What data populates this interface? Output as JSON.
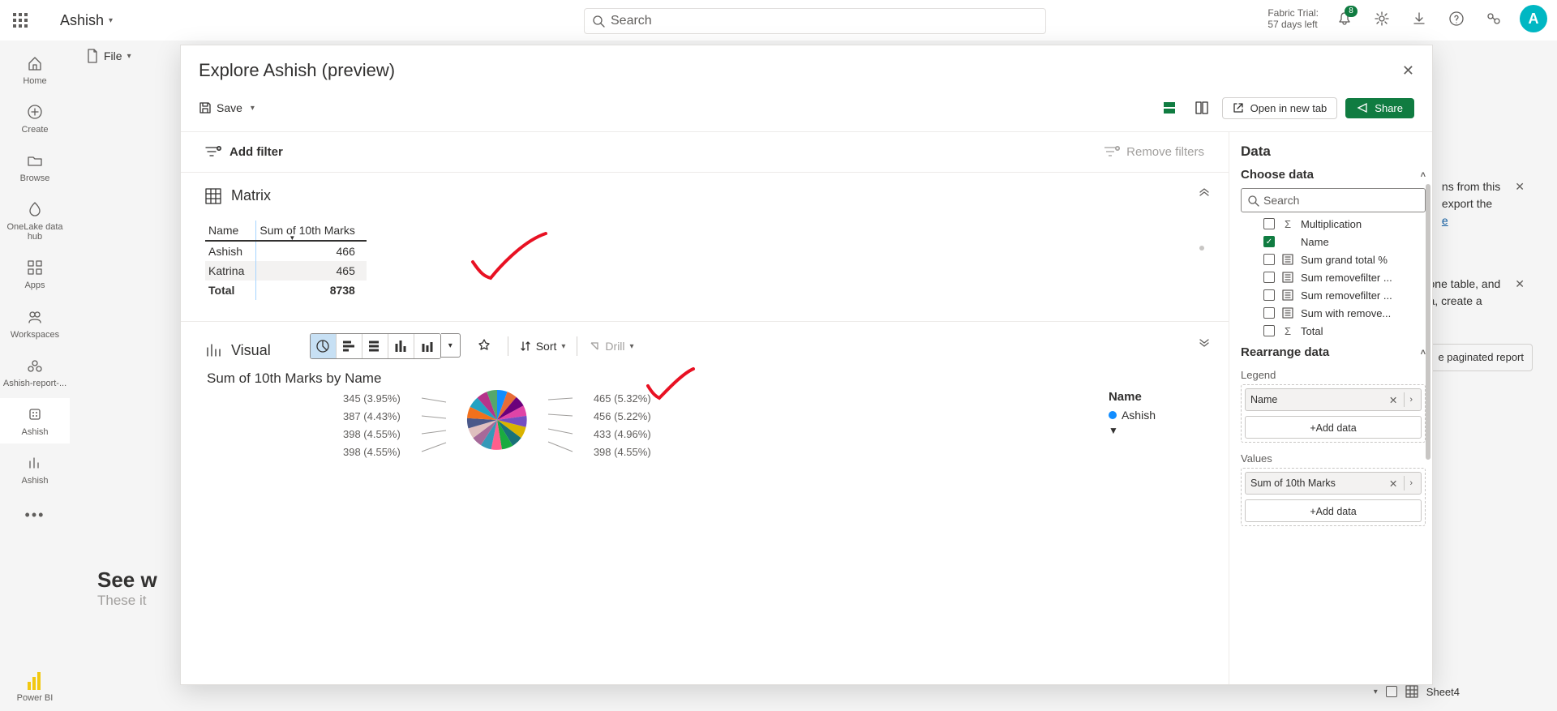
{
  "top": {
    "user": "Ashish",
    "search_placeholder": "Search",
    "trial_line1": "Fabric Trial:",
    "trial_line2": "57 days left",
    "notif_count": "8",
    "avatar_initial": "A"
  },
  "rail": {
    "items": [
      {
        "label": "Home"
      },
      {
        "label": "Create"
      },
      {
        "label": "Browse"
      },
      {
        "label": "OneLake data hub"
      },
      {
        "label": "Apps"
      },
      {
        "label": "Workspaces"
      },
      {
        "label": "Ashish-report-..."
      },
      {
        "label": "Ashish"
      },
      {
        "label": "Ashish"
      }
    ],
    "bottom_label": "Power BI"
  },
  "secondary": {
    "file": "File"
  },
  "bg": {
    "see_title": "See w",
    "these_sub": "These it"
  },
  "peek1": {
    "line1": "ns from this",
    "line2": "export the"
  },
  "peek2": {
    "line1": "one table, and",
    "line2": "a, create a"
  },
  "peek3": {
    "label": "e paginated report"
  },
  "sheet_peek": {
    "label": "Sheet4"
  },
  "modal": {
    "title": "Explore Ashish (preview)",
    "save": "Save",
    "open_new_tab": "Open in new tab",
    "share": "Share",
    "add_filter": "Add filter",
    "remove_filters": "Remove filters",
    "matrix": {
      "title": "Matrix",
      "col_name": "Name",
      "col_sum": "Sum of 10th Marks",
      "rows": [
        {
          "name": "Ashish",
          "val": "466"
        },
        {
          "name": "Katrina",
          "val": "465"
        }
      ],
      "total_label": "Total",
      "total_val": "8738"
    },
    "visual": {
      "title": "Visual",
      "sort": "Sort",
      "drill": "Drill",
      "chart_title": "Sum of 10th Marks by Name",
      "left_labels": [
        "345 (3.95%)",
        "387 (4.43%)",
        "398 (4.55%)",
        "398 (4.55%)"
      ],
      "right_labels": [
        "465 (5.32%)",
        "456 (5.22%)",
        "433 (4.96%)",
        "398 (4.55%)"
      ],
      "legend_title": "Name",
      "legend_item": "Ashish"
    }
  },
  "datapanel": {
    "title": "Data",
    "choose": "Choose data",
    "search_placeholder": "Search",
    "fields": [
      {
        "label": "Multiplication",
        "checked": false,
        "icon": "sigma"
      },
      {
        "label": "Name",
        "checked": true,
        "icon": "none"
      },
      {
        "label": "Sum grand total %",
        "checked": false,
        "icon": "calc"
      },
      {
        "label": "Sum removefilter ...",
        "checked": false,
        "icon": "calc"
      },
      {
        "label": "Sum removefilter ...",
        "checked": false,
        "icon": "calc"
      },
      {
        "label": "Sum with remove...",
        "checked": false,
        "icon": "calc"
      },
      {
        "label": "Total",
        "checked": false,
        "icon": "sigma"
      }
    ],
    "rearrange": "Rearrange data",
    "legend_label": "Legend",
    "legend_pill": "Name",
    "add_data": "+Add data",
    "values_label": "Values",
    "values_pill": "Sum of 10th Marks"
  },
  "chart_data": {
    "type": "pie",
    "title": "Sum of 10th Marks by Name",
    "total": 8738,
    "series": [
      {
        "name": "Ashish",
        "value": 466
      },
      {
        "name": "Katrina",
        "value": 465
      },
      {
        "name": "(slice)",
        "value": 456
      },
      {
        "name": "(slice)",
        "value": 433
      },
      {
        "name": "(slice)",
        "value": 398
      },
      {
        "name": "(slice)",
        "value": 398
      },
      {
        "name": "(slice)",
        "value": 398
      },
      {
        "name": "(slice)",
        "value": 387
      },
      {
        "name": "(slice)",
        "value": 345
      }
    ],
    "visible_labels_left": [
      {
        "value": 345,
        "pct": 3.95
      },
      {
        "value": 387,
        "pct": 4.43
      },
      {
        "value": 398,
        "pct": 4.55
      },
      {
        "value": 398,
        "pct": 4.55
      }
    ],
    "visible_labels_right": [
      {
        "value": 465,
        "pct": 5.32
      },
      {
        "value": 456,
        "pct": 5.22
      },
      {
        "value": 433,
        "pct": 4.96
      },
      {
        "value": 398,
        "pct": 4.55
      }
    ],
    "legend": [
      "Ashish"
    ]
  }
}
